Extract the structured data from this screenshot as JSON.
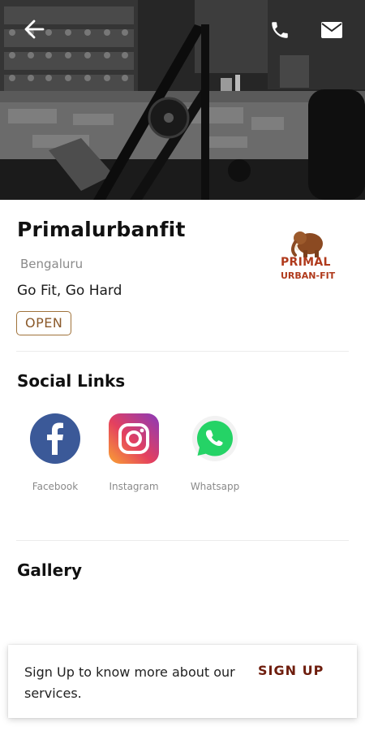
{
  "header": {
    "back_icon": "arrow-left-icon",
    "phone_icon": "phone-icon",
    "mail_icon": "mail-icon"
  },
  "gym": {
    "name": "Primalurbanfit",
    "city": "Bengaluru",
    "tagline": "Go Fit, Go Hard",
    "status": "OPEN",
    "logo_line1": "PRIMAL",
    "logo_line2": "URBAN-FIT"
  },
  "social": {
    "title": "Social Links",
    "items": [
      {
        "label": "Facebook",
        "icon": "facebook-icon",
        "color": "#3b5998"
      },
      {
        "label": "Instagram",
        "icon": "instagram-icon",
        "color": "#e1306c"
      },
      {
        "label": "Whatsapp",
        "icon": "whatsapp-icon",
        "color": "#25d366"
      }
    ]
  },
  "gallery": {
    "title": "Gallery"
  },
  "signup": {
    "text": "Sign Up to know more about our services.",
    "button": "SIGN UP"
  },
  "colors": {
    "accent": "#6e1d0d",
    "badge_border": "#a0733b",
    "logo": "#b03a1c"
  }
}
